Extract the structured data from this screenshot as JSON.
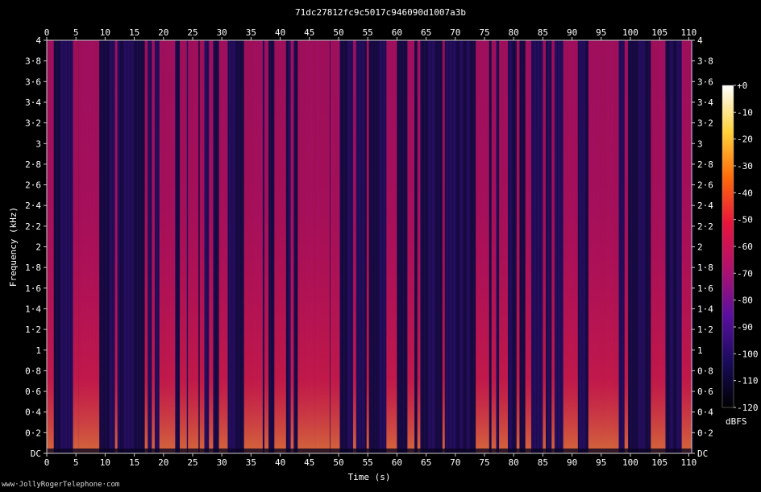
{
  "chart_data": {
    "type": "heatmap",
    "title": "71dc27812fc9c5017c946090d1007a3b",
    "xlabel": "Time (s)",
    "ylabel": "Frequency (kHz)",
    "xlim": [
      0,
      110.5
    ],
    "ylim": [
      0,
      4
    ],
    "x_ticks": [
      0,
      5,
      10,
      15,
      20,
      25,
      30,
      35,
      40,
      45,
      50,
      55,
      60,
      65,
      70,
      75,
      80,
      85,
      90,
      95,
      100,
      105,
      110
    ],
    "y_ticks": [
      "DC",
      "0·2",
      "0·4",
      "0·6",
      "0·8",
      "1",
      "1·2",
      "1·4",
      "1·6",
      "1·8",
      "2",
      "2·2",
      "2·4",
      "2·6",
      "2·8",
      "3",
      "3·2",
      "3·4",
      "3·6",
      "3·8",
      "4"
    ],
    "colorbar": {
      "label": "dBFS",
      "range": [
        -120,
        0
      ],
      "ticks": [
        "+0",
        "-10",
        "-20",
        "-30",
        "-40",
        "-50",
        "-60",
        "-70",
        "-80",
        "-90",
        "-100",
        "-110",
        "-120"
      ],
      "colors": [
        "#000000",
        "#1a0b5c",
        "#5a0fa0",
        "#b0106e",
        "#e8143c",
        "#ff6a0a",
        "#ffd23a",
        "#ffffff"
      ]
    },
    "loud_segments_s": [
      [
        0,
        1.2
      ],
      [
        4.5,
        5.5
      ],
      [
        5.5,
        9
      ],
      [
        11.7,
        12.1
      ],
      [
        16.8,
        17.3
      ],
      [
        18,
        18.5
      ],
      [
        19.3,
        22
      ],
      [
        22.8,
        24
      ],
      [
        24.2,
        26
      ],
      [
        26.2,
        27
      ],
      [
        27.8,
        28.5
      ],
      [
        29.5,
        31
      ],
      [
        33.8,
        37
      ],
      [
        37.3,
        38
      ],
      [
        39,
        41
      ],
      [
        41.8,
        42.3
      ],
      [
        43,
        46
      ],
      [
        46,
        48.5
      ],
      [
        48.6,
        50.2
      ],
      [
        52.5,
        53
      ],
      [
        54.8,
        55.2
      ],
      [
        58.2,
        60
      ],
      [
        61.8,
        63
      ],
      [
        63.5,
        64
      ],
      [
        67.8,
        68.2
      ],
      [
        73.5,
        75.8
      ],
      [
        76.2,
        77
      ],
      [
        77.5,
        79
      ],
      [
        80.5,
        81
      ],
      [
        82,
        83
      ],
      [
        85,
        85.5
      ],
      [
        86.5,
        87
      ],
      [
        88.5,
        91
      ],
      [
        92.8,
        98
      ],
      [
        99,
        99.6
      ],
      [
        103.5,
        106
      ],
      [
        108.8,
        110.5
      ]
    ],
    "credit": "www·JollyRogerTelephone·com"
  }
}
